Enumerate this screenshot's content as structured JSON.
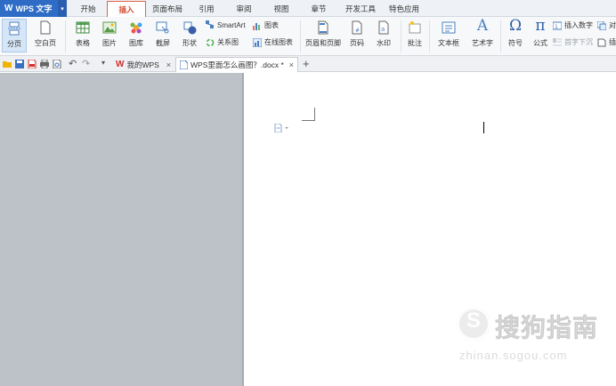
{
  "app": {
    "name": "WPS 文字",
    "logo": "W"
  },
  "menu_tabs": [
    "开始",
    "插入",
    "页面布局",
    "引用",
    "审阅",
    "视图",
    "章节",
    "开发工具",
    "特色应用"
  ],
  "active_tab": "插入",
  "ribbon": {
    "page_break": "分页",
    "blank_page": "空白页",
    "table": "表格",
    "picture": "图片",
    "gallery": "图库",
    "screenshot": "截屏",
    "shape": "形状",
    "smartart": "SmartArt",
    "relation": "关系图",
    "chart": "图表",
    "online_chart": "在线图表",
    "header_footer": "页眉和页脚",
    "page_number": "页码",
    "watermark": "水印",
    "comment": "批注",
    "textbox": "文本框",
    "wordart": "艺术字",
    "symbol": "符号",
    "formula": "公式",
    "insert_number": "插入数字",
    "drop_cap": "首字下沉",
    "object_partial": "对",
    "insert_partial": "插"
  },
  "doc_tabs": [
    {
      "label": "我的WPS",
      "close": "×"
    },
    {
      "label": "WPS里面怎么画图？.docx *",
      "close": "×"
    }
  ],
  "new_tab": "+",
  "watermark": {
    "logo_char": "S",
    "text": "搜狗指南",
    "url": "zhinan.sogou.com"
  },
  "colors": {
    "brand": "#2f6cc5",
    "active_tab": "#e0614a",
    "workspace": "#bdc1c8"
  }
}
